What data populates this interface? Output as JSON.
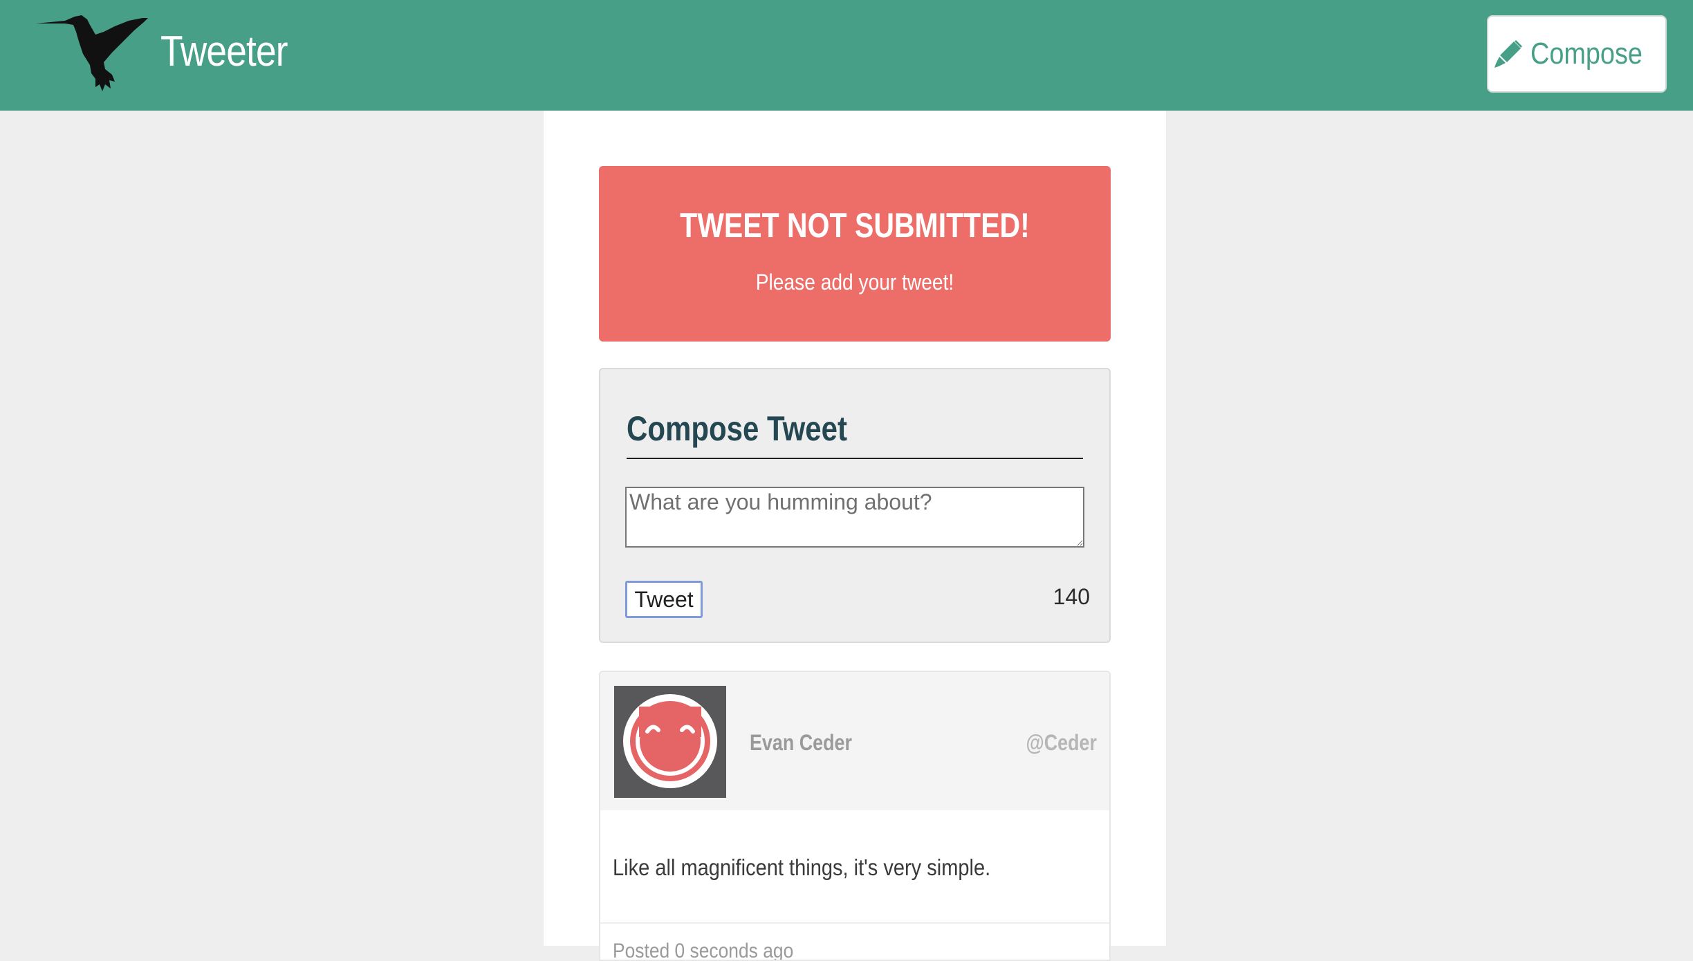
{
  "header": {
    "brand": "Tweeter",
    "logo_icon": "hummingbird-icon",
    "compose_button": {
      "label": "Compose",
      "icon": "pencil-icon"
    }
  },
  "alert": {
    "title": "TWEET NOT SUBMITTED!",
    "message": "Please add your tweet!"
  },
  "compose": {
    "title": "Compose Tweet",
    "placeholder": "What are you humming about?",
    "value": "",
    "submit_label": "Tweet",
    "char_count": "140"
  },
  "tweets": [
    {
      "avatar_icon": "smiley-avatar",
      "name": "Evan Ceder",
      "handle": "@Ceder",
      "text": "Like all magnificent things, it's very simple.",
      "posted": "Posted 0 seconds ago"
    }
  ],
  "colors": {
    "header_bg": "#479f88",
    "alert_bg": "#ed6d68",
    "title_text": "#244751",
    "page_bg": "#eeeeee",
    "button_focus": "#7e9ad8"
  }
}
